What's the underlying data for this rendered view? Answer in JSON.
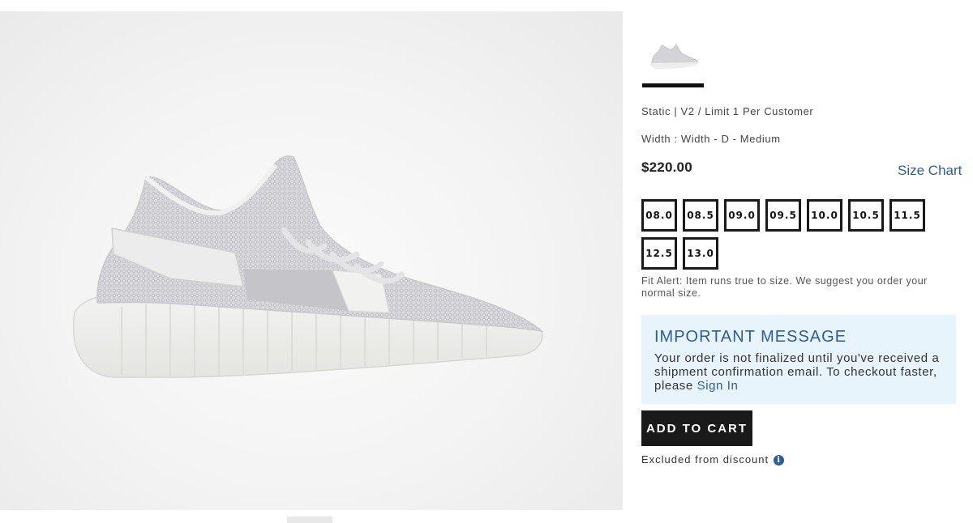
{
  "product": {
    "subtitle": "Static | V2 / Limit 1 Per Customer",
    "width": "Width : Width - D - Medium",
    "price": "$220.00",
    "size_chart_label": "Size Chart"
  },
  "sizes": [
    "08.0",
    "08.5",
    "09.0",
    "09.5",
    "10.0",
    "10.5",
    "11.5",
    "12.5",
    "13.0"
  ],
  "fit_alert": "Fit Alert: Item runs true to size. We suggest you order your normal size.",
  "important_message": {
    "title": "IMPORTANT MESSAGE",
    "body": "Your order is not finalized until you've received a shipment confirmation email. To checkout faster, please",
    "link": "Sign In"
  },
  "add_to_cart_label": "ADD TO CART",
  "excluded_text": "Excluded from discount",
  "icons": {
    "info": "info-icon"
  },
  "colors": {
    "accent": "#2b5d9c",
    "message_bg": "#e8f4fb",
    "button_bg": "#1a1a1a"
  }
}
